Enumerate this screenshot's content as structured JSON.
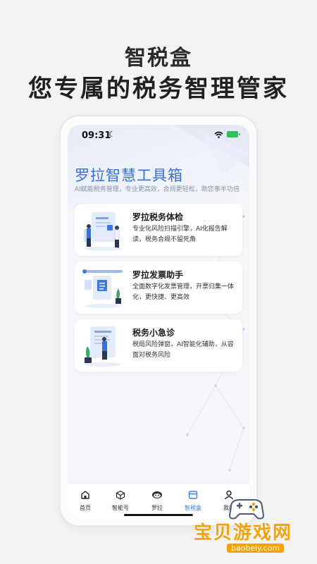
{
  "hero": {
    "title": "智税盒",
    "subtitle": "您专属的税务智理管家"
  },
  "status": {
    "time": "09:31"
  },
  "app": {
    "title": "罗拉智慧工具箱",
    "subtitle": "AI赋能税务管理，专业更高效，合规更轻松，助您事半功倍"
  },
  "cards": [
    {
      "title": "罗拉税务体检",
      "desc": "专业化风险扫描引擎，AI化报告解读，税务合规不留死角"
    },
    {
      "title": "罗拉发票助手",
      "desc": "全面数字化发票管理，开票归集一体化，更快捷、更高效"
    },
    {
      "title": "税务小急诊",
      "desc": "税局风险弹窗，AI智能化辅助，从容面对税务风险"
    }
  ],
  "tabs": [
    {
      "label": "首页",
      "icon": "home-icon"
    },
    {
      "label": "智能号",
      "icon": "cube-icon"
    },
    {
      "label": "罗拉",
      "icon": "mascot-icon"
    },
    {
      "label": "智税盒",
      "icon": "box-icon"
    },
    {
      "label": "我的",
      "icon": "user-icon"
    }
  ],
  "watermark": {
    "text": "宝贝游戏网",
    "url": "baobeiy.com"
  },
  "colors": {
    "accent": "#3b6fd8",
    "active_tab": "#3b7ae0",
    "watermark": "#f2a10f"
  }
}
